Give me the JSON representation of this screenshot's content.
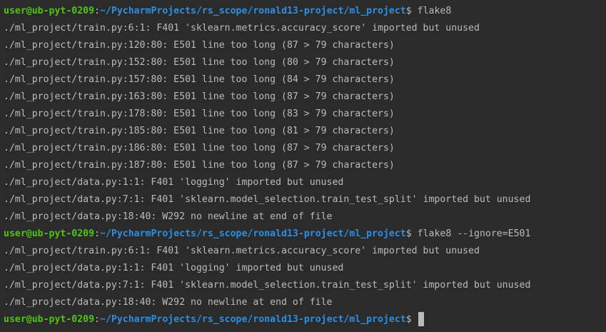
{
  "prompt": {
    "user_host": "user@ub-pyt-0209",
    "separator": ":",
    "path": "~/PycharmProjects/rs_scope/ronald13-project/ml_project",
    "dollar": "$ "
  },
  "colors": {
    "background": "#2b2b2b",
    "text": "#bbbbbb",
    "user_host": "#4fc414",
    "path": "#2d8fe0"
  },
  "command1": "flake8",
  "output1": [
    "./ml_project/train.py:6:1: F401 'sklearn.metrics.accuracy_score' imported but unused",
    "./ml_project/train.py:120:80: E501 line too long (87 > 79 characters)",
    "./ml_project/train.py:152:80: E501 line too long (80 > 79 characters)",
    "./ml_project/train.py:157:80: E501 line too long (84 > 79 characters)",
    "./ml_project/train.py:163:80: E501 line too long (87 > 79 characters)",
    "./ml_project/train.py:178:80: E501 line too long (83 > 79 characters)",
    "./ml_project/train.py:185:80: E501 line too long (81 > 79 characters)",
    "./ml_project/train.py:186:80: E501 line too long (87 > 79 characters)",
    "./ml_project/train.py:187:80: E501 line too long (87 > 79 characters)",
    "./ml_project/data.py:1:1: F401 'logging' imported but unused",
    "./ml_project/data.py:7:1: F401 'sklearn.model_selection.train_test_split' imported but unused",
    "./ml_project/data.py:18:40: W292 no newline at end of file"
  ],
  "command2": "flake8 --ignore=E501",
  "output2": [
    "./ml_project/train.py:6:1: F401 'sklearn.metrics.accuracy_score' imported but unused",
    "./ml_project/data.py:1:1: F401 'logging' imported but unused",
    "./ml_project/data.py:7:1: F401 'sklearn.model_selection.train_test_split' imported but unused",
    "./ml_project/data.py:18:40: W292 no newline at end of file"
  ],
  "command3": ""
}
